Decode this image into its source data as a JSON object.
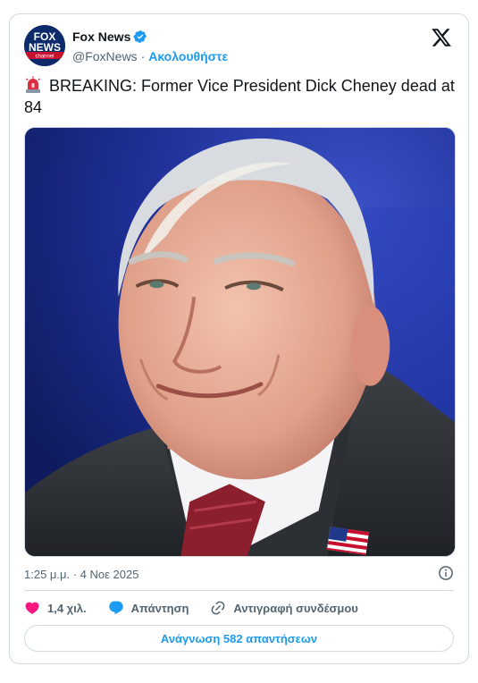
{
  "account": {
    "display_name": "Fox News",
    "handle": "@FoxNews",
    "separator": "·",
    "follow_label": "Ακολουθήστε",
    "logo_text_line1": "FOX",
    "logo_text_line2": "NEWS",
    "logo_text_line3": "channel"
  },
  "tweet": {
    "text": "BREAKING: Former Vice President Dick Cheney dead at 84",
    "timestamp": "1:25 μ.μ. · 4 Νοε 2025"
  },
  "actions": {
    "like_count": "1,4 χιλ.",
    "reply_label": "Απάντηση",
    "copy_link_label": "Αντιγραφή συνδέσμου"
  },
  "read_replies_label": "Ανάγνωση 582 απαντήσεων",
  "icons": {
    "verified": "verified-badge-icon",
    "x_logo": "x-logo-icon",
    "siren": "siren-emoji-icon",
    "info": "info-icon",
    "like": "heart-icon",
    "reply": "speech-bubble-icon",
    "link": "link-icon"
  },
  "colors": {
    "accent": "#1d9bf0",
    "like": "#f91880",
    "text": "#0f1419",
    "muted": "#536471",
    "border": "#cfd9de"
  }
}
